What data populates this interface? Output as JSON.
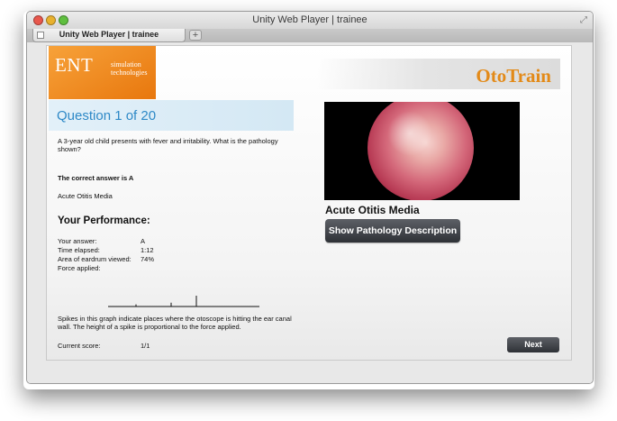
{
  "window": {
    "title": "Unity Web Player | trainee"
  },
  "tabs": [
    {
      "title": "Unity Web Player | trainee"
    }
  ],
  "logo": {
    "main": "ENT",
    "sub": "simulation technologies"
  },
  "brand": "OtoTrain",
  "question": {
    "title": "Question 1 of 20",
    "text": "A 3-year old child presents with fever and irritability.   What is the pathology shown?",
    "correct_label": "The correct answer is A",
    "correct_answer": "Acute Otitis Media"
  },
  "performance": {
    "heading": "Your Performance:",
    "rows": [
      {
        "label": "Your answer:",
        "value": "A"
      },
      {
        "label": "Time elapsed:",
        "value": "1:12"
      },
      {
        "label": "Area of eardrum viewed:",
        "value": "74%"
      },
      {
        "label": "Force applied:",
        "value": ""
      }
    ],
    "graph_note": "Spikes in this graph indicate places where the otoscope is hitting the ear canal wall. The height of a spike is proportional to the force applied.",
    "force_spikes": [
      0.2,
      0.35,
      1.0
    ],
    "score_label": "Current score:",
    "score_value": "1/1"
  },
  "diagnosis": "Acute Otitis Media",
  "buttons": {
    "description": "Show Pathology Description",
    "next": "Next"
  },
  "colors": {
    "accent_orange": "#e8770d",
    "brand_text": "#e38a18",
    "question_blue": "#2e89c7",
    "button_dark": "#3a3d42"
  }
}
